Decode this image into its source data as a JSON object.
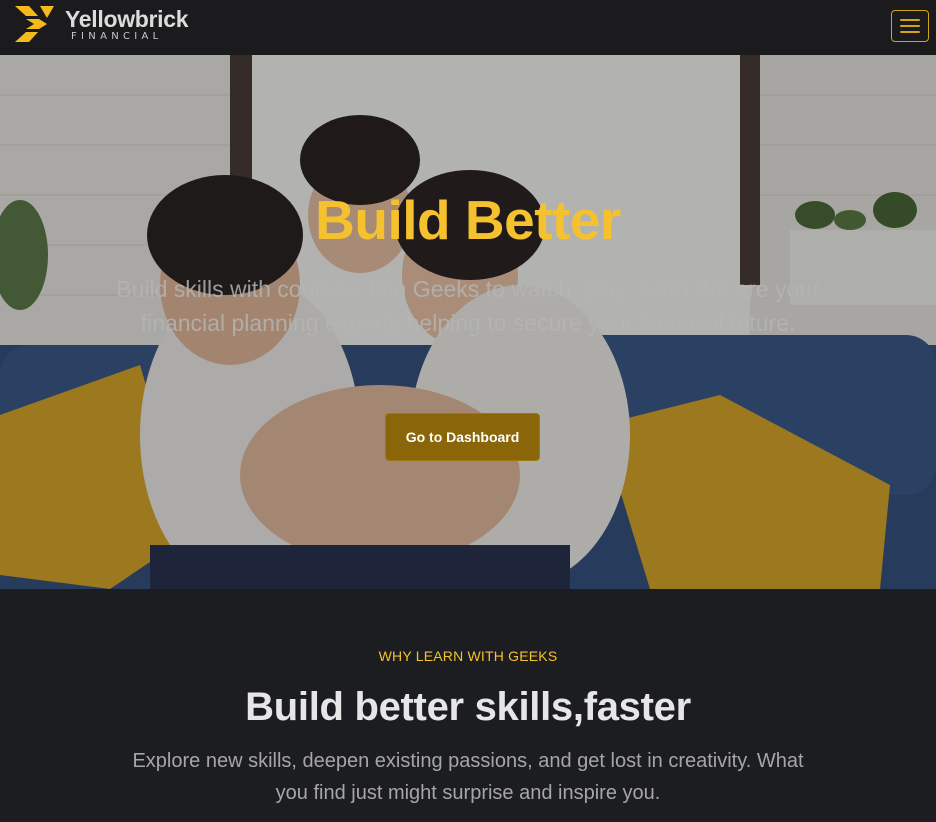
{
  "navbar": {
    "brand_name": "Yellowbrick",
    "brand_sub": "FINANCIAL",
    "logo_icon": "yellowbrick-chevron-logo",
    "menu_icon": "hamburger-menu-icon",
    "accent_color": "#d4a417"
  },
  "hero": {
    "title": "Build Better",
    "subtitle": "Build skills with courses Join Geeks to watch, play, learn,We are your financial planning experts helping to secure your financial future.",
    "cta_label": "Go to Dashboard",
    "title_color": "#f5c12e",
    "cta_color": "#8a6608"
  },
  "features": {
    "eyebrow": "WHY LEARN WITH GEEKS",
    "title": "Build better skills,faster",
    "description": "Explore new skills, deepen existing passions, and get lost in creativity. What you find just might surprise and inspire you."
  }
}
